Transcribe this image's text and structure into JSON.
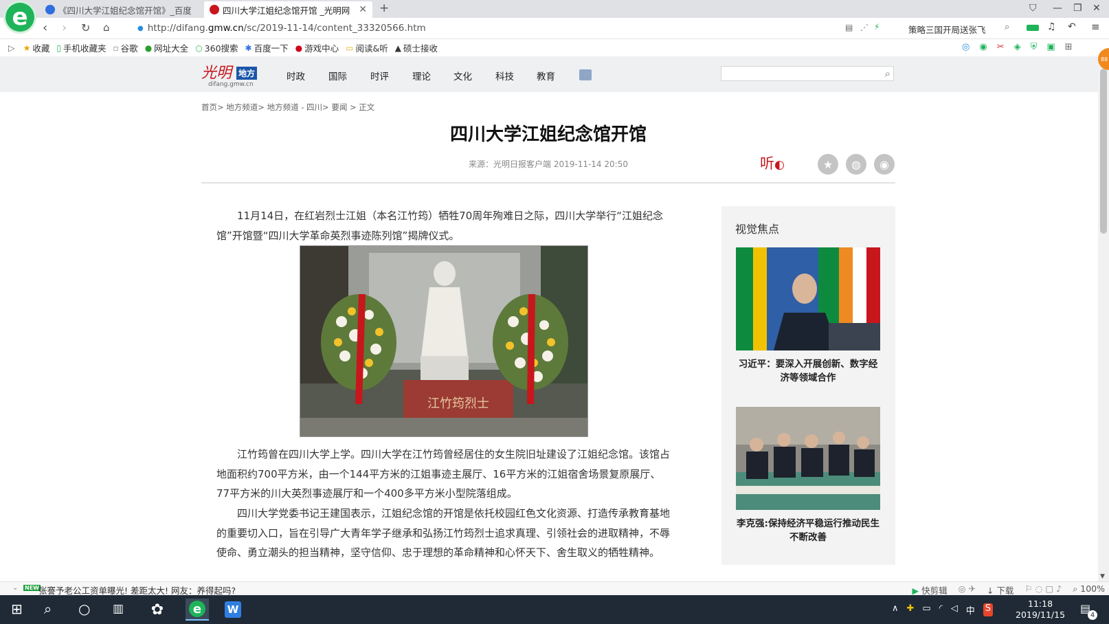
{
  "browser": {
    "tabs": [
      {
        "label": "《四川大学江姐纪念馆开馆》_百度"
      },
      {
        "label": "四川大学江姐纪念馆开馆 _光明网"
      }
    ],
    "url_prefix": "http://difang.",
    "url_domain": "gmw.cn",
    "url_path": "/sc/2019-11-14/content_33320566.htm",
    "toolbar_news": "策略三国开局送张飞",
    "bookmarks": [
      "收藏",
      "手机收藏夹",
      "谷歌",
      "网址大全",
      "360搜索",
      "百度一下",
      "游戏中心",
      "阅读&听",
      "硕士接收"
    ],
    "notif_count": "88"
  },
  "site": {
    "logo_main": "光明",
    "logo_badge": "地方",
    "logo_domain": "difang.gmw.cn",
    "nav": [
      "时政",
      "国际",
      "时评",
      "理论",
      "文化",
      "科技",
      "教育"
    ]
  },
  "article": {
    "breadcrumb": "首页> 地方频道> 地方频道 - 四川> 要闻 > 正文",
    "title": "四川大学江姐纪念馆开馆",
    "meta": "来源：光明日报客户端 2019-11-14 20:50",
    "listen": "听",
    "paragraphs": [
      "11月14日，在红岩烈士江姐（本名江竹筠）牺牲70周年殉难日之际，四川大学举行“江姐纪念馆”开馆暨“四川大学革命英烈事迹陈列馆”揭牌仪式。",
      "江竹筠曾在四川大学上学。四川大学在江竹筠曾经居住的女生院旧址建设了江姐纪念馆。该馆占地面积约700平方米，由一个144平方米的江姐事迹主展厅、16平方米的江姐宿舍场景复原展厅、77平方米的川大英烈事迹展厅和一个400多平方米小型院落组成。",
      "四川大学党委书记王建国表示，江姐纪念馆的开馆是依托校园红色文化资源、打造传承教育基地的重要切入口，旨在引导广大青年学子继承和弘扬江竹筠烈士追求真理、引领社会的进取精神，不辱使命、勇立潮头的担当精神，坚守信仰、忠于理想的革命精神和心怀天下、舍生取义的牺牲精神。"
    ],
    "photo_plaque": "江竹筠烈士"
  },
  "sidebar": {
    "title": "视觉焦点",
    "items": [
      {
        "caption": "习近平：要深入开展创新、数字经济等领域合作"
      },
      {
        "caption": "李克强:保持经济平稳运行推动民生不断改善"
      }
    ]
  },
  "statusbar": {
    "badge": "NEW",
    "news": "张謇予老公工资单曝光! 差距太大! 网友：养得起吗?",
    "right": [
      "快剪辑",
      "下载",
      "100%"
    ]
  },
  "taskbar": {
    "time": "11:18",
    "date": "2019/11/15",
    "ime": "中",
    "notify_count": "4"
  },
  "colors": {
    "brand_red": "#c8161d",
    "brand_blue": "#1a56a8",
    "taskbar": "#1f2a36"
  }
}
